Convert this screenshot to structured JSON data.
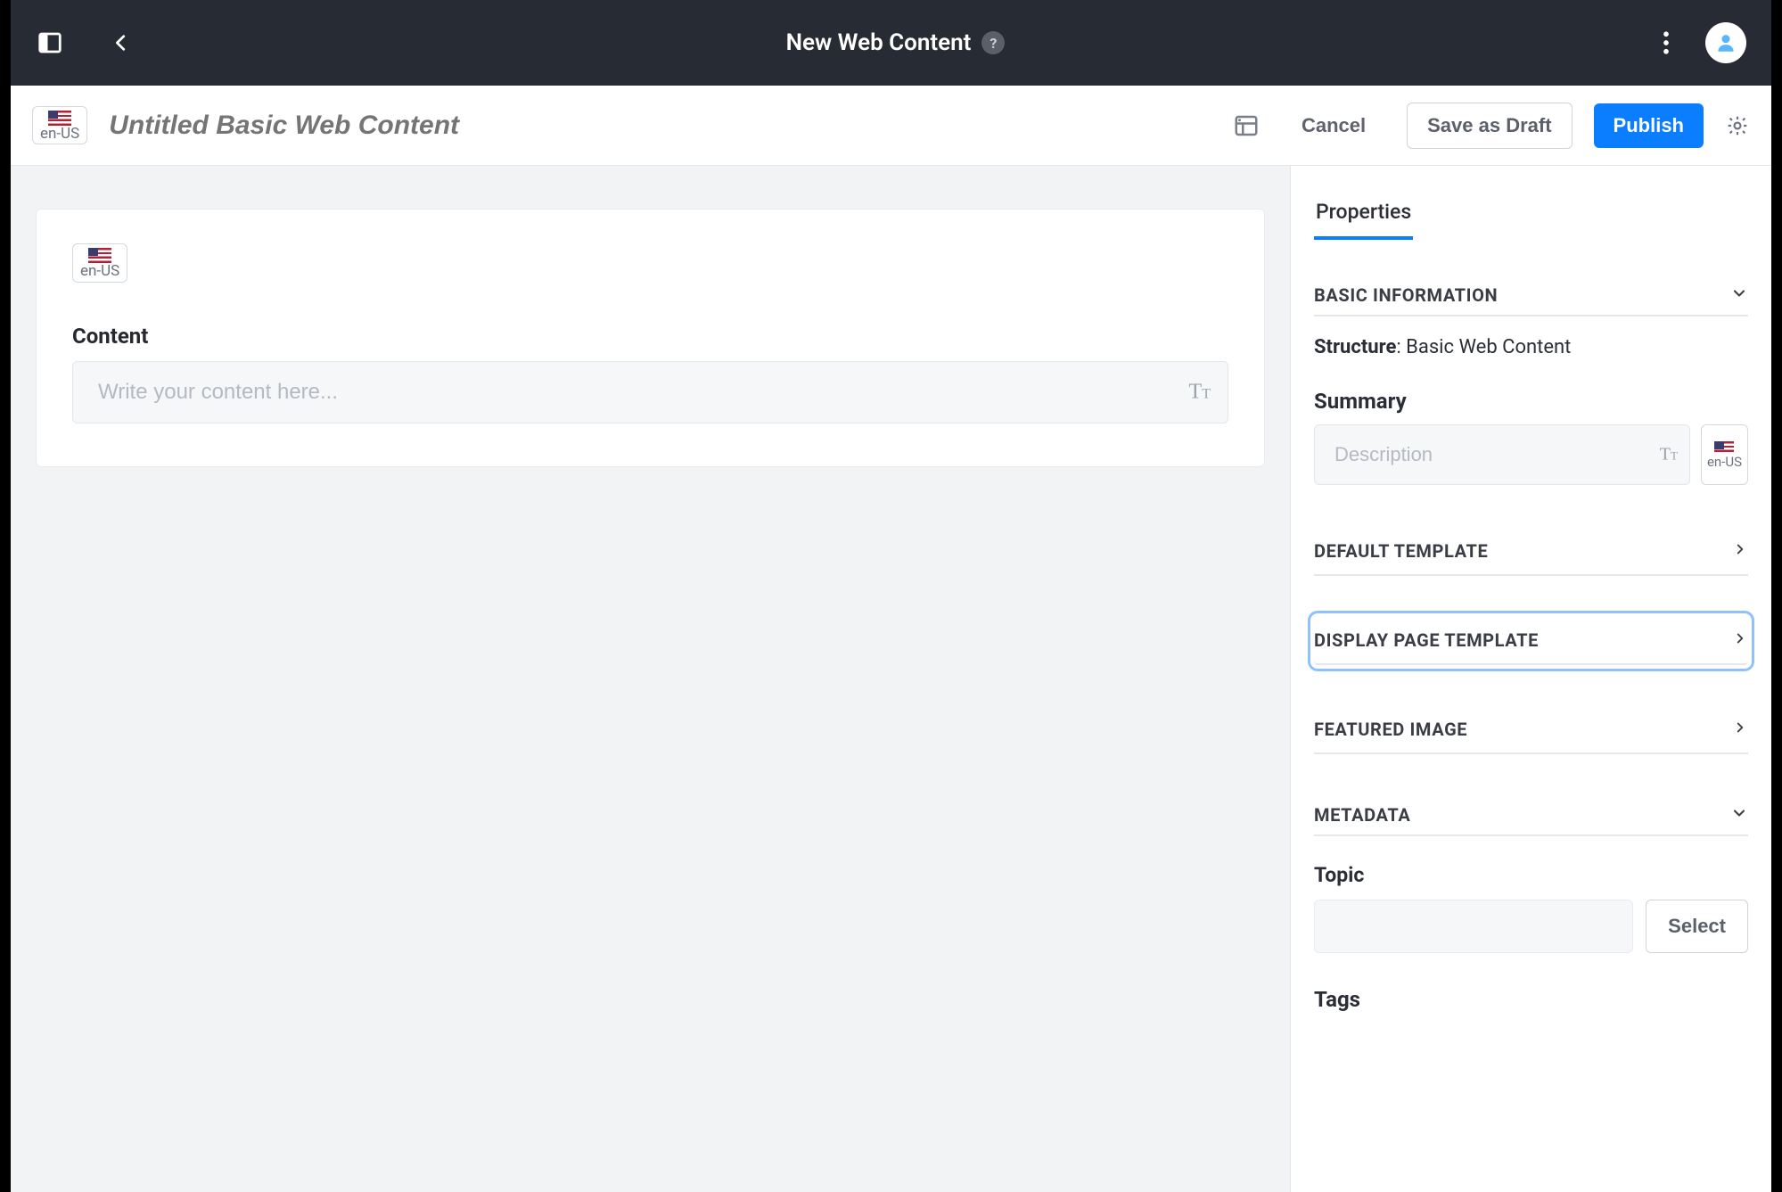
{
  "header": {
    "page_title": "New Web Content",
    "help_label": "?"
  },
  "subbar": {
    "locale_label": "en-US",
    "title_placeholder": "Untitled Basic Web Content",
    "cancel": "Cancel",
    "save_draft": "Save as Draft",
    "publish": "Publish"
  },
  "editor": {
    "locale_label": "en-US",
    "content_label": "Content",
    "content_placeholder": "Write your content here..."
  },
  "sidebar": {
    "tab_properties": "Properties",
    "sections": {
      "basic_info": {
        "title": "BASIC INFORMATION",
        "structure_label": "Structure",
        "structure_value": "Basic Web Content",
        "summary_label": "Summary",
        "summary_placeholder": "Description",
        "locale_label": "en-US"
      },
      "default_template": {
        "title": "DEFAULT TEMPLATE"
      },
      "display_page_template": {
        "title": "DISPLAY PAGE TEMPLATE"
      },
      "featured_image": {
        "title": "FEATURED IMAGE"
      },
      "metadata": {
        "title": "METADATA",
        "topic_label": "Topic",
        "select_label": "Select",
        "tags_label": "Tags"
      }
    }
  }
}
